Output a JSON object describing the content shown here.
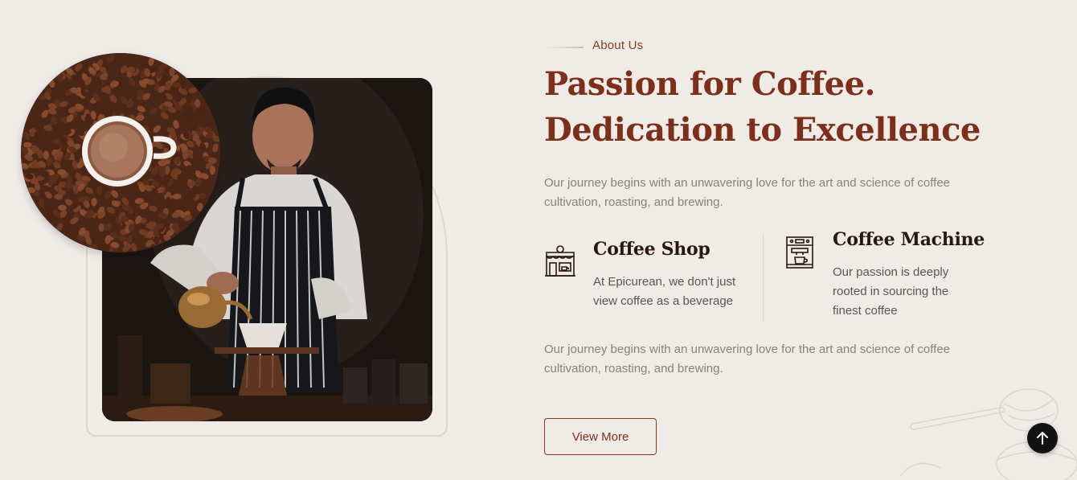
{
  "about": {
    "label": "About Us"
  },
  "heading": {
    "line1": "Passion for Coffee.",
    "line2": "Dedication to Excellence"
  },
  "intro_paragraph": "Our journey begins with an unwavering love for the art and science of coffee cultivation, roasting, and brewing.",
  "features": [
    {
      "icon": "coffee-shop-icon",
      "title": "Coffee Shop",
      "description": "At Epicurean, we don't just view coffee as a beverage"
    },
    {
      "icon": "coffee-machine-icon",
      "title": "Coffee Machine",
      "description": "Our passion is deeply rooted in sourcing the finest coffee"
    }
  ],
  "closing_paragraph": "Our journey begins with an unwavering love for the art and science of coffee cultivation, roasting, and brewing.",
  "cta": {
    "label": "View More"
  },
  "scroll_top": {
    "icon": "arrow-up-icon"
  },
  "colors": {
    "background": "#efebe7",
    "accent": "#7e2f1b",
    "heading_dark": "#2a1612",
    "body_text": "#8a817c",
    "scroll_button": "#111213"
  }
}
